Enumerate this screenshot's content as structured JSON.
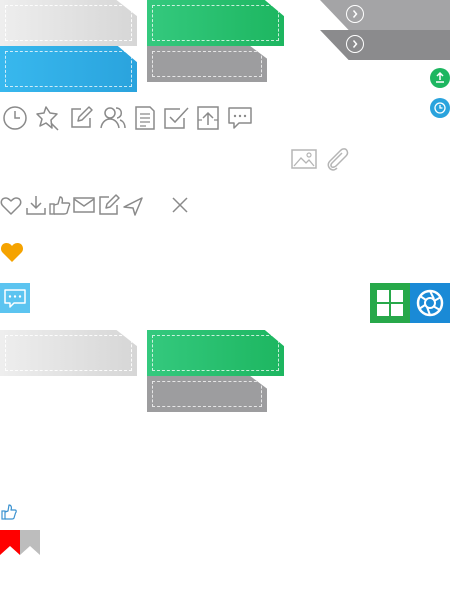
{
  "colors": {
    "green": "#1db660",
    "blue": "#2aa3dd",
    "gray": "#9d9d9f",
    "light_gray": "#e4e4e4",
    "heart_orange": "#f5a300",
    "chat_blue": "#5cc4f0",
    "tile_green": "#27a84a",
    "tile_blue": "#1a8ad6",
    "flag_red": "#ff0000",
    "flag_gray": "#bdbdbd"
  },
  "icons": {
    "row1": [
      "clock-icon",
      "pin-icon",
      "edit-icon",
      "users-icon",
      "document-icon",
      "checkbox-icon",
      "upload-box-icon",
      "comment-icon"
    ],
    "row2": [
      "image-icon",
      "attachment-icon"
    ],
    "row3": [
      "heart-outline-icon",
      "download-icon",
      "thumbs-up-icon",
      "mail-icon",
      "edit-icon",
      "send-icon",
      "close-icon"
    ],
    "status": [
      "upload-circle-icon",
      "clock-circle-icon"
    ],
    "tiles": [
      "windows-icon",
      "camera-aperture-icon"
    ]
  }
}
